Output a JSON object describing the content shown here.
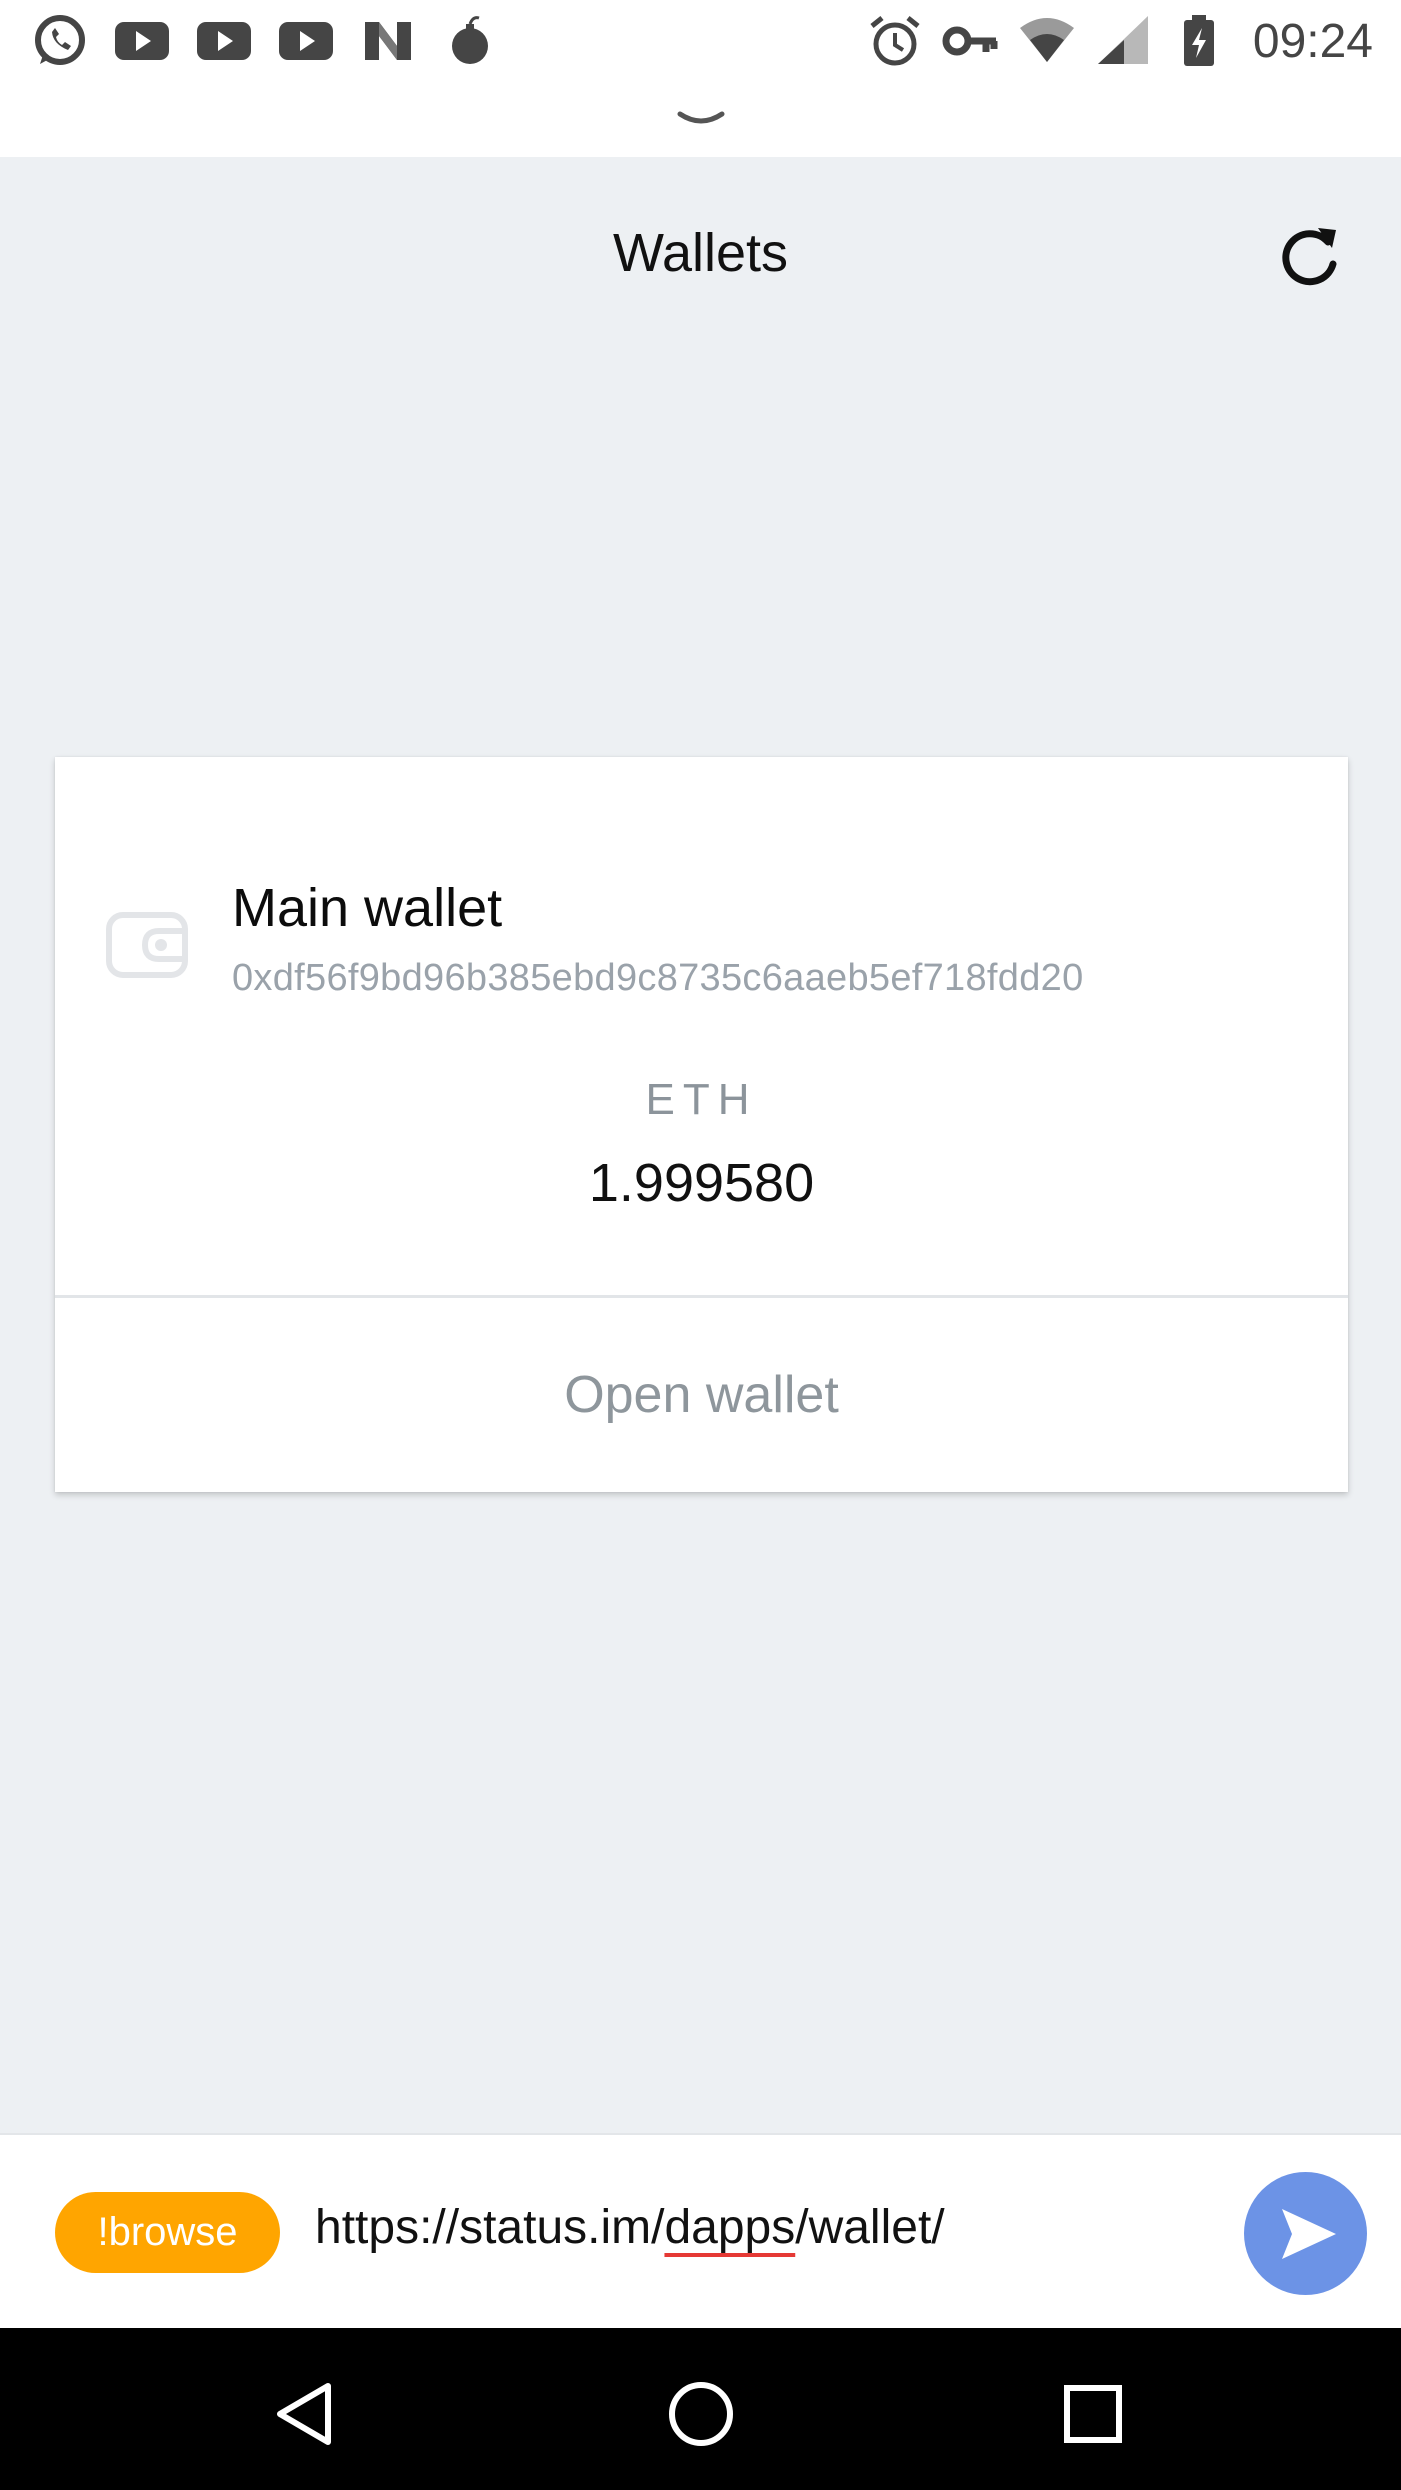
{
  "status_bar": {
    "time": "09:24",
    "left_icons": [
      "whatsapp-icon",
      "youtube-icon",
      "youtube-icon",
      "youtube-icon",
      "n-app-icon",
      "bomb-icon"
    ],
    "right_icons": [
      "alarm-icon",
      "key-icon",
      "wifi-icon",
      "cell-signal-icon",
      "battery-charging-icon"
    ]
  },
  "header": {
    "title": "Wallets",
    "refresh_icon": "refresh-icon"
  },
  "wallet_card": {
    "name": "Main wallet",
    "address": "0xdf56f9bd96b385ebd9c8735c6aaeb5ef718fdd20",
    "currency": "ETH",
    "balance": "1.999580",
    "open_label": "Open wallet",
    "icon": "wallet-icon"
  },
  "input_bar": {
    "command_chip": "!browse",
    "url_prefix": "https://status.im/",
    "url_misspelled": "dapps",
    "url_suffix": "/wallet/",
    "send_icon": "send-icon"
  },
  "nav_bar": {
    "icons": [
      "back-icon",
      "home-icon",
      "recents-icon"
    ]
  },
  "colors": {
    "background": "#edf0f3",
    "chip": "#ffa500",
    "send_button": "#6c93e6",
    "muted_text": "#9aa2aa"
  }
}
